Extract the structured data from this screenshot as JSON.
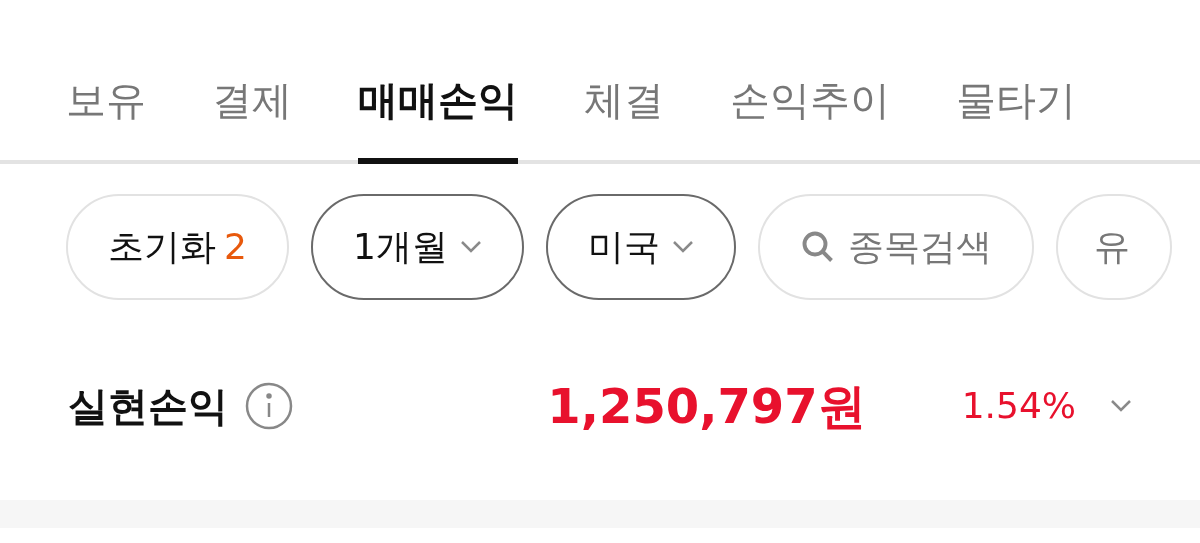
{
  "tabs": [
    {
      "label": "보유",
      "selected": false
    },
    {
      "label": "결제",
      "selected": false
    },
    {
      "label": "매매손익",
      "selected": true
    },
    {
      "label": "체결",
      "selected": false
    },
    {
      "label": "손익추이",
      "selected": false
    },
    {
      "label": "물타기",
      "selected": false
    }
  ],
  "filters": [
    {
      "kind": "reset",
      "label": "초기화",
      "count": "2"
    },
    {
      "kind": "dropdown",
      "label": "1개월"
    },
    {
      "kind": "dropdown",
      "label": "미국"
    },
    {
      "kind": "search",
      "label": "종목검색"
    },
    {
      "kind": "plain",
      "label": "유"
    }
  ],
  "summary": {
    "label": "실현손익",
    "amount": "1,250,797원",
    "percent": "1.54%"
  }
}
